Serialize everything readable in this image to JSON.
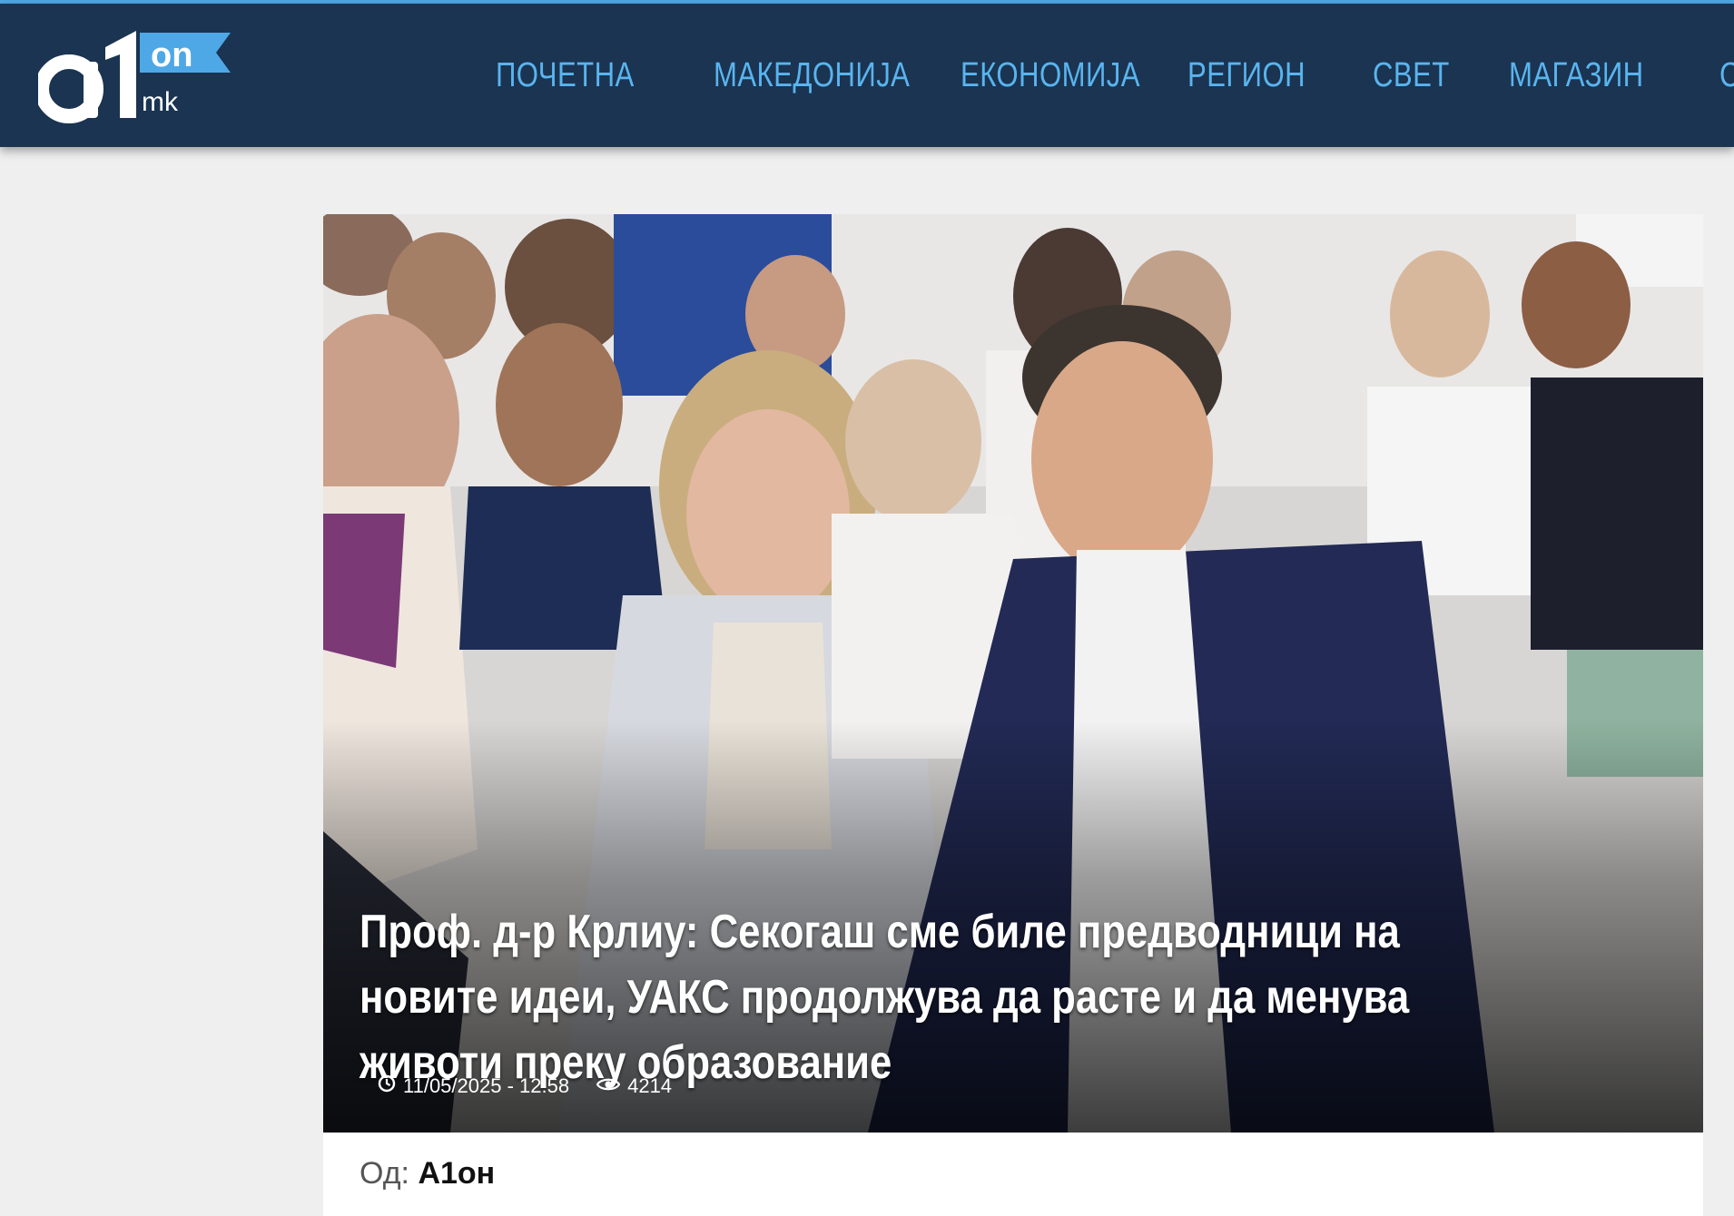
{
  "site": {
    "logo_main": "a1",
    "logo_on": "on",
    "logo_mk": "mk"
  },
  "nav": {
    "items": [
      {
        "label": "ПОЧЕТНА"
      },
      {
        "label": "МАКЕДОНИЈА"
      },
      {
        "label": "ЕКОНОМИЈА"
      },
      {
        "label": "РЕГИОН"
      },
      {
        "label": "СВЕТ"
      },
      {
        "label": "МАГАЗИН"
      },
      {
        "label": "СПОРТ"
      }
    ]
  },
  "article": {
    "title": "Проф. д-р Крлиу: Секогаш сме биле предводници на новите идеи, УАКС продолжува да расте и да менува животи преку образование",
    "date": "11/05/2025 - 12:58",
    "views": "4214",
    "author_prefix": "Од:",
    "author_name": "А1он"
  },
  "colors": {
    "header_bg": "#1a3451",
    "nav_text": "#5ab4ee",
    "accent": "#4fa8e6"
  }
}
